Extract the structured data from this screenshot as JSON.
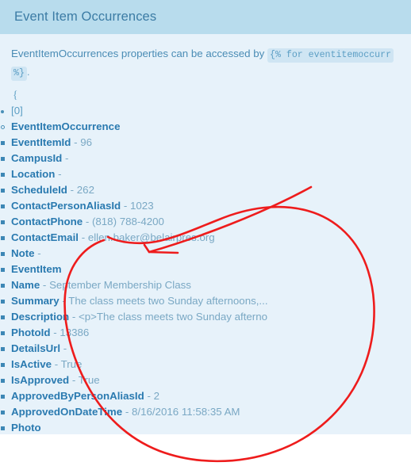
{
  "panel": {
    "title": "Event Item Occurrences"
  },
  "intro": {
    "text_before": "EventItemOccurrences properties can be accessed by",
    "code_line1": "{% for eventitemoccurr",
    "code_line2": "%}",
    "period": "."
  },
  "tree": {
    "open_brace": "{",
    "index_label": "[0]",
    "root_label": "EventItemOccurrence",
    "occurrence_fields": [
      {
        "key": "EventItemId",
        "sep": "-",
        "value": "96"
      },
      {
        "key": "CampusId",
        "sep": "-",
        "value": ""
      },
      {
        "key": "Location",
        "sep": "-",
        "value": ""
      },
      {
        "key": "ScheduleId",
        "sep": "-",
        "value": "262"
      },
      {
        "key": "ContactPersonAliasId",
        "sep": "-",
        "value": "1023"
      },
      {
        "key": "ContactPhone",
        "sep": "-",
        "value": "(818) 788-4200"
      },
      {
        "key": "ContactEmail",
        "sep": "-",
        "value": "ellen.baker@belairpres.org"
      },
      {
        "key": "Note",
        "sep": "-",
        "value": ""
      }
    ],
    "eventitem_label": "EventItem",
    "eventitem_fields": [
      {
        "key": "Name",
        "sep": "-",
        "value": "September Membership Class"
      },
      {
        "key": "Summary",
        "sep": "-",
        "value": "The class meets two Sunday afternoons,..."
      },
      {
        "key": "Description",
        "sep": "-",
        "value": "<p>The class meets two Sunday afterno"
      },
      {
        "key": "PhotoId",
        "sep": "-",
        "value": "13386"
      },
      {
        "key": "DetailsUrl",
        "sep": "-",
        "value": ""
      },
      {
        "key": "IsActive",
        "sep": "-",
        "value": "True"
      },
      {
        "key": "IsApproved",
        "sep": "-",
        "value": "True"
      },
      {
        "key": "ApprovedByPersonAliasId",
        "sep": "-",
        "value": "2"
      },
      {
        "key": "ApprovedOnDateTime",
        "sep": "-",
        "value": "8/16/2016 11:58:35 AM"
      },
      {
        "key": "Photo",
        "sep": "",
        "value": ""
      }
    ]
  },
  "annotation": {
    "color": "#ee1c1c",
    "shapes": [
      "hand-drawn-oval",
      "pointer-arrow"
    ]
  }
}
